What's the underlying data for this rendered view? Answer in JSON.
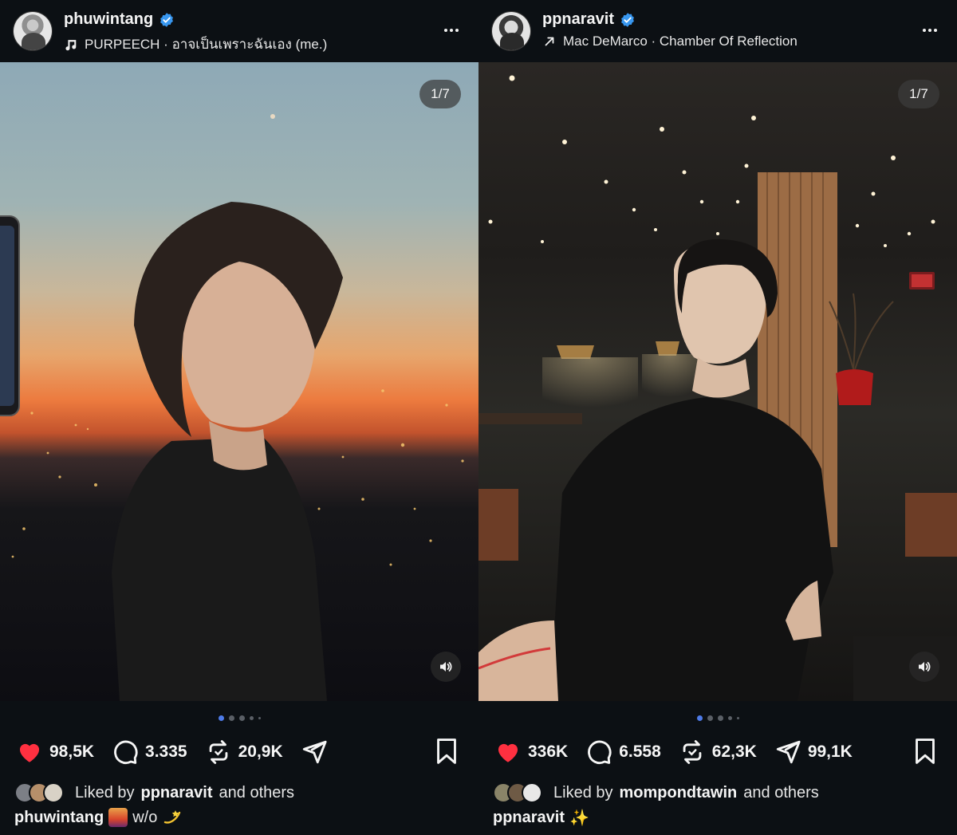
{
  "posts": [
    {
      "username": "phuwintang",
      "audio": "PURPEECH · อาจเป็นเพราะฉันเอง (me.)",
      "audio_icon": "music-note-icon",
      "counter": "1/7",
      "likes": "98,5K",
      "comments": "3.335",
      "reposts": "20,9K",
      "shares": "",
      "liked_by_prefix": "Liked by",
      "liked_by_user": "ppnaravit",
      "liked_by_suffix": "and others",
      "caption_user": "phuwintang",
      "caption_text": "w/o",
      "caption_emoji_1": "sunset-emoji",
      "caption_emoji_2": "dizzy-emoji"
    },
    {
      "username": "ppnaravit",
      "audio": "Mac DeMarco · Chamber Of Reflection",
      "audio_icon": "arrow-up-right-icon",
      "counter": "1/7",
      "likes": "336K",
      "comments": "6.558",
      "reposts": "62,3K",
      "shares": "99,1K",
      "liked_by_prefix": "Liked by",
      "liked_by_user": "mompondtawin",
      "liked_by_suffix": "and others",
      "caption_user": "ppnaravit",
      "caption_text": "✨",
      "caption_emoji_1": "sparkles-emoji"
    }
  ],
  "colors": {
    "background": "#0c1014",
    "verified": "#3897f0",
    "like": "#ff3040",
    "active_dot": "#4e7be8"
  }
}
